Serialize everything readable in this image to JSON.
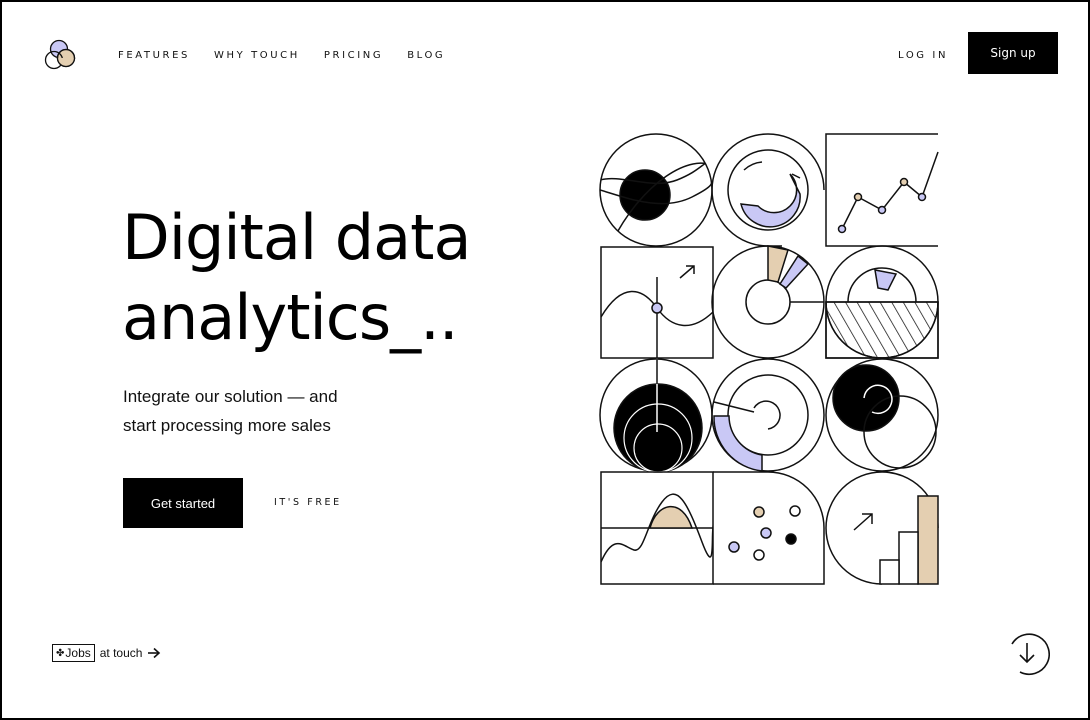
{
  "brand": {
    "logo_icon": "three-circles-logo-icon",
    "colors": {
      "lavender": "#c9c8f5",
      "sand": "#e4cfb1",
      "black": "#000000",
      "white": "#ffffff"
    }
  },
  "nav": {
    "items": [
      {
        "label": "FEATURES"
      },
      {
        "label": "WHY TOUCH"
      },
      {
        "label": "PRICING"
      },
      {
        "label": "BLOG"
      }
    ],
    "login_label": "LOG IN",
    "signup_label": "Sign up"
  },
  "hero": {
    "title_line1": "Digital data",
    "title_line2": "analytics_..",
    "subtitle_line1": "Integrate our solution — and",
    "subtitle_line2": "start processing more sales",
    "cta_label": "Get started",
    "cta_note": "IT'S FREE"
  },
  "footer": {
    "jobs_badge": "Jobs",
    "jobs_text": "at touch",
    "jobs_arrow_icon": "arrow-right-icon",
    "scroll_icon": "arrow-down-circle-icon"
  }
}
